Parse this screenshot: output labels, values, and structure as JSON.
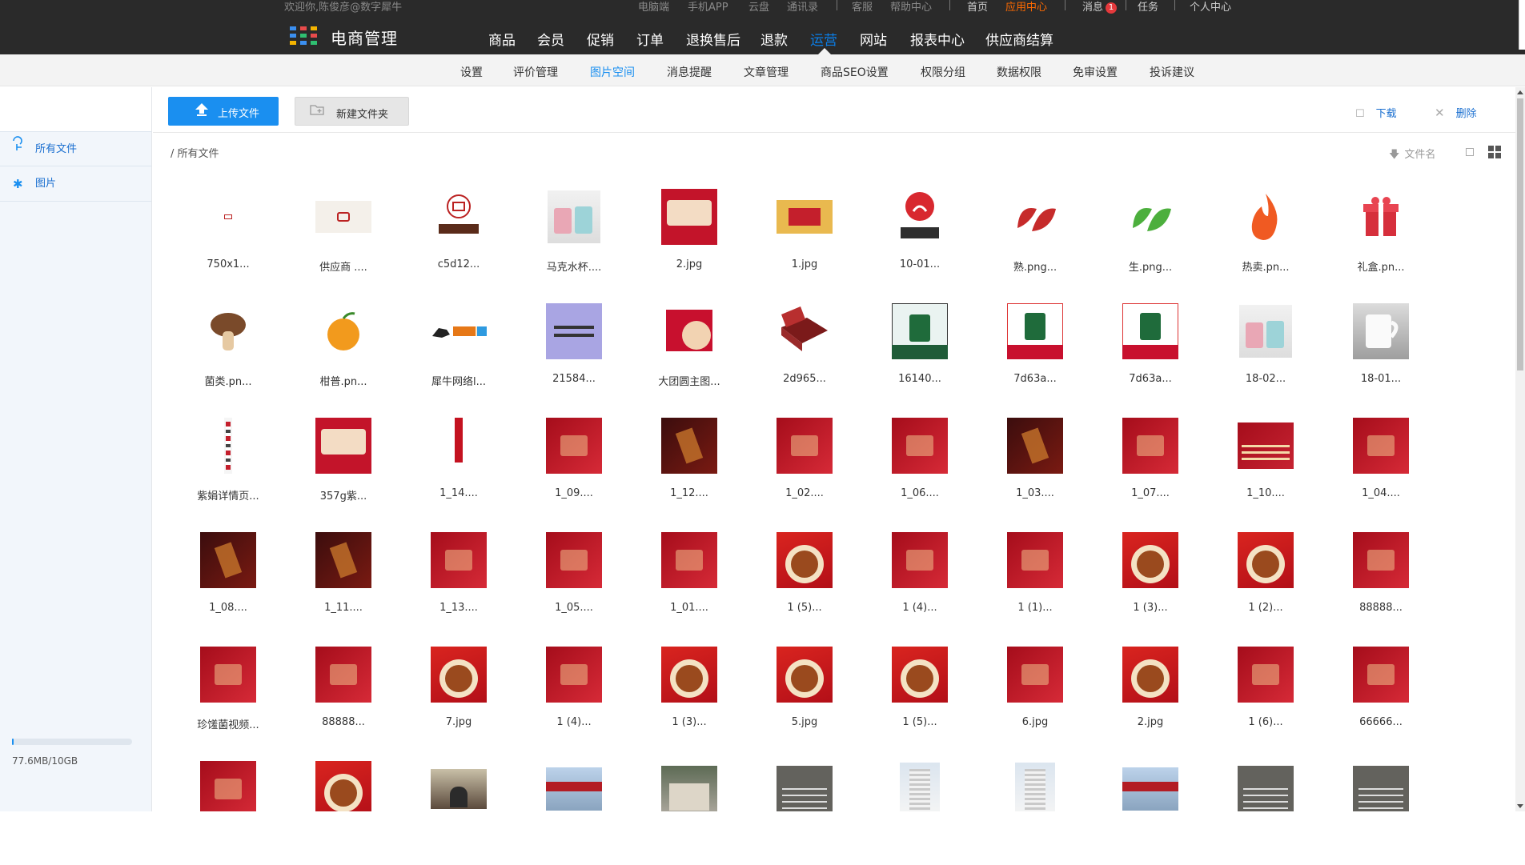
{
  "topbar": {
    "welcome": "欢迎你,陈俊彦@数字犀牛",
    "links": [
      "电脑端",
      "手机APP",
      "云盘",
      "通讯录",
      "客服",
      "帮助中心"
    ],
    "home": "首页",
    "app_center": "应用中心",
    "messages": "消息",
    "message_count": "1",
    "tasks": "任务",
    "personal": "个人中心"
  },
  "header": {
    "brand": "电商管理",
    "logo_colors": [
      "#3b8ff0",
      "#e84b4b",
      "#f5b400",
      "#3b8ff0",
      "#2fbf71",
      "#e84b4b",
      "#f5b400",
      "#3b8ff0",
      "#2fbf71"
    ],
    "nav": [
      "商品",
      "会员",
      "促销",
      "订单",
      "退换售后",
      "退款",
      "运营",
      "网站",
      "报表中心",
      "供应商结算"
    ],
    "nav_active": "运营"
  },
  "subnav": {
    "items": [
      "设置",
      "评价管理",
      "图片空间",
      "消息提醒",
      "文章管理",
      "商品SEO设置",
      "权限分组",
      "数据权限",
      "免审设置",
      "投诉建议"
    ],
    "active": "图片空间"
  },
  "sidebar": {
    "items": [
      {
        "label": "所有文件",
        "icon": "folder-tree-icon"
      },
      {
        "label": "图片",
        "icon": "asterisk-icon"
      }
    ],
    "quota": "77.6MB/10GB",
    "quota_fraction": 0.0076
  },
  "toolbar": {
    "upload": "上传文件",
    "new_folder": "新建文件夹",
    "download": "下载",
    "delete": "删除",
    "sort_label": "文件名"
  },
  "breadcrumb": "/ 所有文件",
  "files": [
    {
      "name": "750x1...",
      "thumb": "logo-small"
    },
    {
      "name": "供应商 ....",
      "thumb": "logo-wide"
    },
    {
      "name": "c5d12...",
      "thumb": "logo-seal"
    },
    {
      "name": "马克水杯....",
      "thumb": "mugs"
    },
    {
      "name": "2.jpg",
      "thumb": "red-card"
    },
    {
      "name": "1.jpg",
      "thumb": "banner"
    },
    {
      "name": "10-01...",
      "thumb": "weibo-logo"
    },
    {
      "name": "熟.png...",
      "thumb": "leaf-red"
    },
    {
      "name": "生.png...",
      "thumb": "leaf-green"
    },
    {
      "name": "热卖.pn...",
      "thumb": "flame"
    },
    {
      "name": "礼盒.pn...",
      "thumb": "gift"
    },
    {
      "name": "菌类.pn...",
      "thumb": "mushroom"
    },
    {
      "name": "柑普.pn...",
      "thumb": "orange"
    },
    {
      "name": "犀牛网络l...",
      "thumb": "rhino-logo"
    },
    {
      "name": "21584...",
      "thumb": "lavender"
    },
    {
      "name": "大团圆主图...",
      "thumb": "tea-cake"
    },
    {
      "name": "2d965...",
      "thumb": "box-open"
    },
    {
      "name": "16140...",
      "thumb": "tin-green"
    },
    {
      "name": "7d63a...",
      "thumb": "tin-red"
    },
    {
      "name": "7d63a...",
      "thumb": "tin-red"
    },
    {
      "name": "18-02...",
      "thumb": "mugs"
    },
    {
      "name": "18-01...",
      "thumb": "mug-white"
    },
    {
      "name": "紫娟详情页...",
      "thumb": "long-strip"
    },
    {
      "name": "357g紫...",
      "thumb": "red-card"
    },
    {
      "name": "1_14....",
      "thumb": "thin-strip"
    },
    {
      "name": "1_09....",
      "thumb": "crimson"
    },
    {
      "name": "1_12....",
      "thumb": "dark"
    },
    {
      "name": "1_02....",
      "thumb": "crimson"
    },
    {
      "name": "1_06....",
      "thumb": "crimson"
    },
    {
      "name": "1_03....",
      "thumb": "dark"
    },
    {
      "name": "1_07....",
      "thumb": "crimson"
    },
    {
      "name": "1_10....",
      "thumb": "crimson-wide"
    },
    {
      "name": "1_04....",
      "thumb": "crimson"
    },
    {
      "name": "1_08....",
      "thumb": "dark"
    },
    {
      "name": "1_11....",
      "thumb": "dark"
    },
    {
      "name": "1_13....",
      "thumb": "crimson"
    },
    {
      "name": "1_05....",
      "thumb": "crimson"
    },
    {
      "name": "1_01....",
      "thumb": "crimson"
    },
    {
      "name": "1 (5)...",
      "thumb": "bowl"
    },
    {
      "name": "1 (4)...",
      "thumb": "crimson"
    },
    {
      "name": "1 (1)...",
      "thumb": "crimson"
    },
    {
      "name": "1 (3)...",
      "thumb": "bowl"
    },
    {
      "name": "1 (2)...",
      "thumb": "bowl"
    },
    {
      "name": "88888...",
      "thumb": "crimson"
    },
    {
      "name": "珍馐菌视频...",
      "thumb": "crimson"
    },
    {
      "name": "88888...",
      "thumb": "crimson"
    },
    {
      "name": "7.jpg",
      "thumb": "bowl"
    },
    {
      "name": "1 (4)...",
      "thumb": "crimson"
    },
    {
      "name": "1 (3)...",
      "thumb": "bowl"
    },
    {
      "name": "5.jpg",
      "thumb": "bowl"
    },
    {
      "name": "1 (5)...",
      "thumb": "bowl"
    },
    {
      "name": "6.jpg",
      "thumb": "crimson"
    },
    {
      "name": "2.jpg",
      "thumb": "bowl"
    },
    {
      "name": "1 (6)...",
      "thumb": "crimson"
    },
    {
      "name": "66666...",
      "thumb": "crimson"
    },
    {
      "name": "",
      "thumb": "crimson"
    },
    {
      "name": "",
      "thumb": "bowl"
    },
    {
      "name": "",
      "thumb": "photo"
    },
    {
      "name": "",
      "thumb": "storefront"
    },
    {
      "name": "",
      "thumb": "building-old"
    },
    {
      "name": "",
      "thumb": "gray-doc"
    },
    {
      "name": "",
      "thumb": "tower"
    },
    {
      "name": "",
      "thumb": "tower"
    },
    {
      "name": "",
      "thumb": "storefront"
    },
    {
      "name": "",
      "thumb": "gray-doc"
    },
    {
      "name": "",
      "thumb": "gray-doc"
    }
  ]
}
